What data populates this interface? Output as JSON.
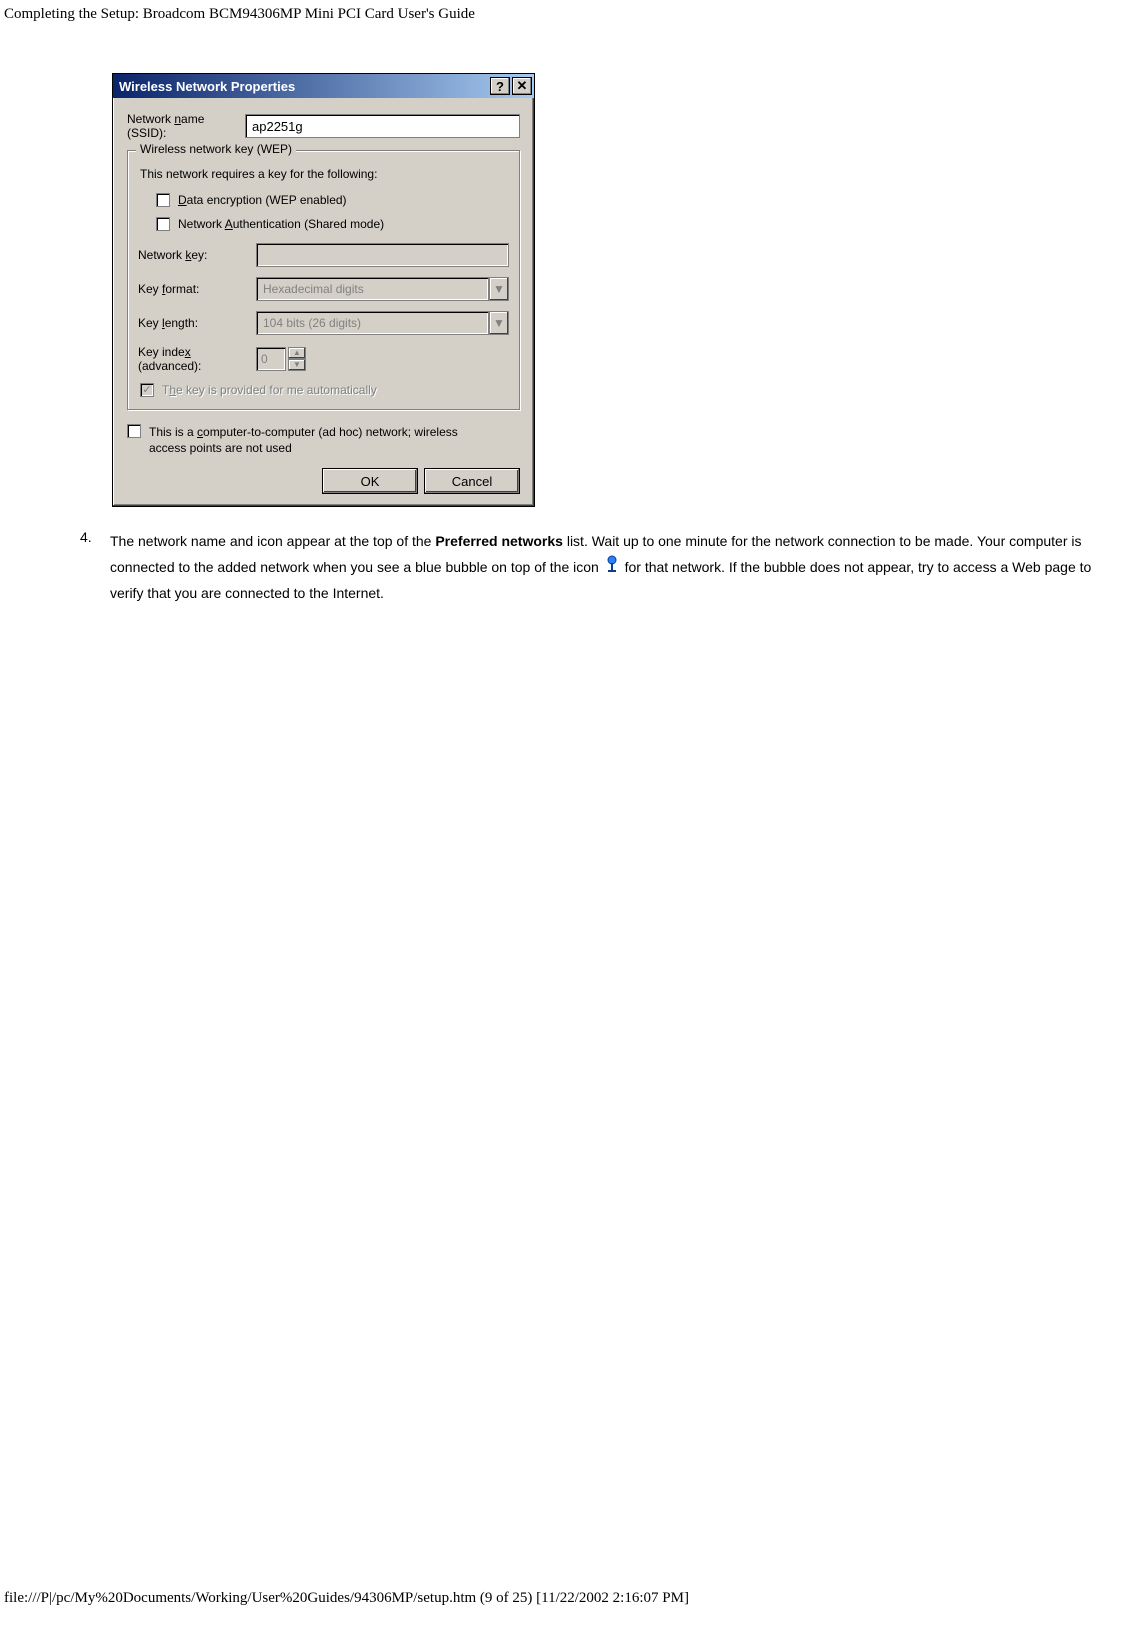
{
  "page": {
    "header": "Completing the Setup: Broadcom BCM94306MP Mini PCI Card User's Guide",
    "footer": "file:///P|/pc/My%20Documents/Working/User%20Guides/94306MP/setup.htm (9 of 25) [11/22/2002 2:16:07 PM]"
  },
  "dialog": {
    "title": "Wireless Network Properties",
    "help_btn": "?",
    "close_btn": "✕",
    "ssid_label_pre": "Network ",
    "ssid_label_ul": "n",
    "ssid_label_post": "ame (SSID):",
    "ssid_value": "ap2251g",
    "wep_legend": "Wireless network key (WEP)",
    "wep_text": "This network requires a key for the following:",
    "chk_data_ul": "D",
    "chk_data_post": "ata encryption (WEP enabled)",
    "chk_auth_pre": "Network ",
    "chk_auth_ul": "A",
    "chk_auth_post": "uthentication (Shared mode)",
    "netkey_pre": "Network ",
    "netkey_ul": "k",
    "netkey_post": "ey:",
    "netkey_value": "",
    "keyformat_pre": "Key ",
    "keyformat_ul": "f",
    "keyformat_post": "ormat:",
    "keyformat_value": "Hexadecimal digits",
    "keylen_pre": "Key ",
    "keylen_ul": "l",
    "keylen_post": "ength:",
    "keylen_value": "104 bits (26 digits)",
    "keyidx_pre": "Key inde",
    "keyidx_ul": "x",
    "keyidx_post": " (advanced):",
    "keyidx_value": "0",
    "auto_pre": "T",
    "auto_ul": "h",
    "auto_post": "e key is provided for me automatically",
    "adhoc_pre": "This is a ",
    "adhoc_ul": "c",
    "adhoc_post": "omputer-to-computer (ad hoc) network; wireless access points are not used",
    "ok": "OK",
    "cancel": "Cancel"
  },
  "step": {
    "num": "4.",
    "part1": "The network name and icon appear at the top of the ",
    "bold": "Preferred networks",
    "part2": " list. Wait up to one minute for the network connection to be made. Your computer is connected to the added network when you see a blue bubble on top of the icon ",
    "part3": " for that network. If the bubble does not appear, try to access a Web page to verify that you are connected to the Internet."
  }
}
